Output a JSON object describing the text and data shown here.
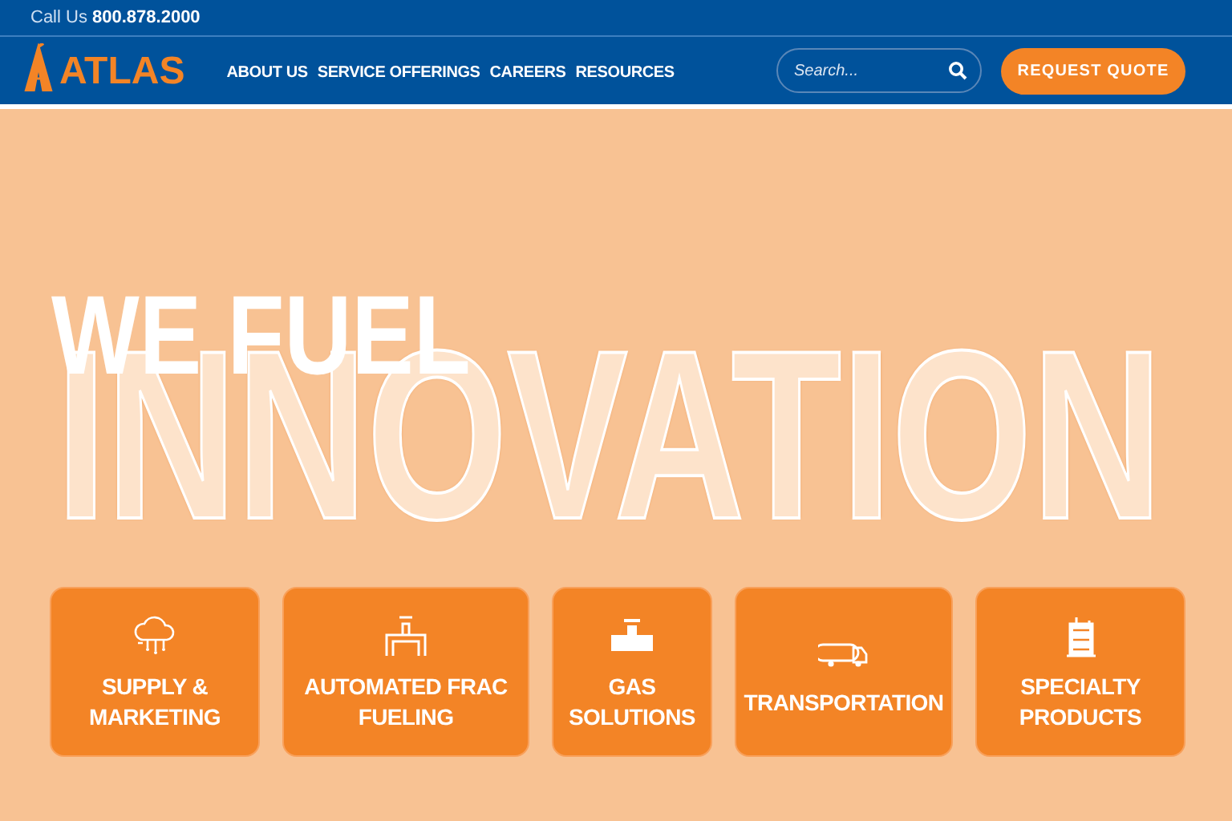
{
  "top_bar": {
    "phone": "Call Us **800.878.2000**"
  },
  "header": {
    "logo": "ATLAS",
    "nav": [
      {
        "label": "ABOUT US"
      },
      {
        "label": "SERVICE OFFERINGS"
      },
      {
        "label": "CAREERS"
      },
      {
        "label": "RESOURCES"
      }
    ],
    "search": {
      "placeholder": "Search..."
    },
    "cta": "REQUEST QUOTE"
  },
  "hero": {
    "headline": "WE FUEL",
    "outline_word": "INNOVATION"
  },
  "services": [
    {
      "label": "SUPPLY & MARKETING"
    },
    {
      "label": "AUTOMATED FRAC FUELING"
    },
    {
      "label": "GAS SOLUTIONS"
    },
    {
      "label": "TRANSPORTATION"
    },
    {
      "label": "SPECIALTY PRODUCTS"
    }
  ]
}
